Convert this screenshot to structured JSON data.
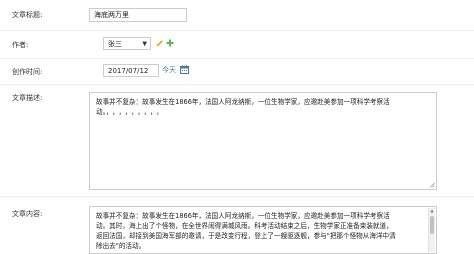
{
  "form": {
    "title": {
      "label": "文章标题:",
      "value": "海底两万里"
    },
    "author": {
      "label": "作者:",
      "selected": "张三"
    },
    "created": {
      "label": "创作时间:",
      "value": "2017/07/12",
      "today_link": "今天"
    },
    "description": {
      "label": "文章描述:",
      "line1": "故事并不复杂：故事发生在1866年，法国人阿龙纳斯，一位生物学家，应邀赴美参加一项科学考察活",
      "line2": "动。",
      "ellipsis": "，，，，，，，，，"
    },
    "content": {
      "label": "文章内容:",
      "lines": [
        "故事并不复杂：故事发生在1866年，法国人阿龙纳斯，一位生物学家，应邀赴美参加一项科学考察活",
        "动。其时，海上出了个怪物，在全世界闹得满城风雨。科考活动结束之后，生物学家正准备束装就道，",
        "返回法国，却接到美国海军部的邀请，于是改变行程，登上了一艘驱逐舰，参与\"把那个怪物从海洋中清",
        "除出去\"的活动。"
      ]
    }
  },
  "colors": {
    "edit_icon": "#f0ad00",
    "add_icon": "#5cb85c",
    "link": "#447e9b",
    "calendar": "#447e9b"
  }
}
